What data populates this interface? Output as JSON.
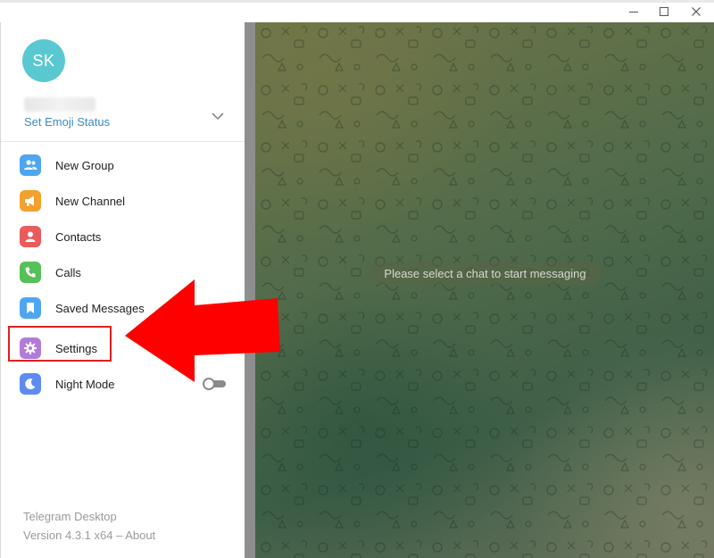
{
  "window": {
    "controls": [
      {
        "name": "minimize-icon"
      },
      {
        "name": "maximize-icon"
      },
      {
        "name": "close-icon"
      }
    ]
  },
  "profile": {
    "initials": "SK",
    "avatar_color": "#5ac8d0",
    "status_link": "Set Emoji Status",
    "toggle_icon": "chevron-down-icon"
  },
  "menu": {
    "items": [
      {
        "label": "New Group",
        "icon": "group-icon",
        "color": "#4fa6f0"
      },
      {
        "label": "New Channel",
        "icon": "megaphone-icon",
        "color": "#f3a02f"
      },
      {
        "label": "Contacts",
        "icon": "person-icon",
        "color": "#ea5b5b"
      },
      {
        "label": "Calls",
        "icon": "phone-icon",
        "color": "#56c158"
      },
      {
        "label": "Saved Messages",
        "icon": "bookmark-icon",
        "color": "#4fa6f0"
      },
      {
        "label": "Settings",
        "icon": "gear-icon",
        "color": "#b27bd8"
      },
      {
        "label": "Night Mode",
        "icon": "moon-icon",
        "color": "#5c8cf0",
        "toggle_on": false
      }
    ]
  },
  "footer": {
    "app_name": "Telegram Desktop",
    "version_text": "Version 4.3.1 x64 – About"
  },
  "chat": {
    "empty_message": "Please select a chat to start messaging"
  },
  "annotation": {
    "highlight_color": "#e11f1f",
    "arrow_color": "#ff0000",
    "target": "Settings"
  }
}
